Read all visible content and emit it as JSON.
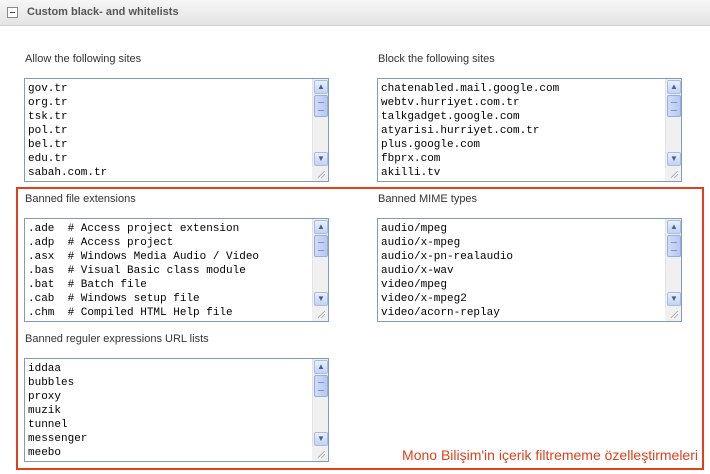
{
  "section": {
    "title": "Custom black- and whitelists"
  },
  "allow": {
    "label": "Allow the following sites",
    "lines": [
      "gov.tr",
      "org.tr",
      "tsk.tr",
      "pol.tr",
      "bel.tr",
      "edu.tr",
      "sabah.com.tr"
    ]
  },
  "block": {
    "label": "Block the following sites",
    "lines": [
      "chatenabled.mail.google.com",
      "webtv.hurriyet.com.tr",
      "talkgadget.google.com",
      "atyarisi.hurriyet.com.tr",
      "plus.google.com",
      "fbprx.com",
      "akilli.tv"
    ]
  },
  "extensions": {
    "label": "Banned file extensions",
    "lines": [
      ".ade  # Access project extension",
      ".adp  # Access project",
      ".asx  # Windows Media Audio / Video",
      ".bas  # Visual Basic class module",
      ".bat  # Batch file",
      ".cab  # Windows setup file",
      ".chm  # Compiled HTML Help file"
    ]
  },
  "mime": {
    "label": "Banned MIME types",
    "lines": [
      "audio/mpeg",
      "audio/x-mpeg",
      "audio/x-pn-realaudio",
      "audio/x-wav",
      "video/mpeg",
      "video/x-mpeg2",
      "video/acorn-replay"
    ]
  },
  "regex": {
    "label": "Banned reguler expressions URL lists",
    "lines": [
      "iddaa",
      "bubbles",
      "proxy",
      "muzik",
      "tunnel",
      "messenger",
      "meebo"
    ]
  },
  "caption": "Mono Bilişim'in içerik filtrememe özelleştirmeleri",
  "colors": {
    "highlight": "#e0401a",
    "textarea_border": "#7f9db9"
  },
  "icons": {
    "collapse": "minus-square-icon",
    "scroll_up": "arrow-up-icon",
    "scroll_down": "arrow-down-icon",
    "resize": "resize-grip-icon"
  }
}
